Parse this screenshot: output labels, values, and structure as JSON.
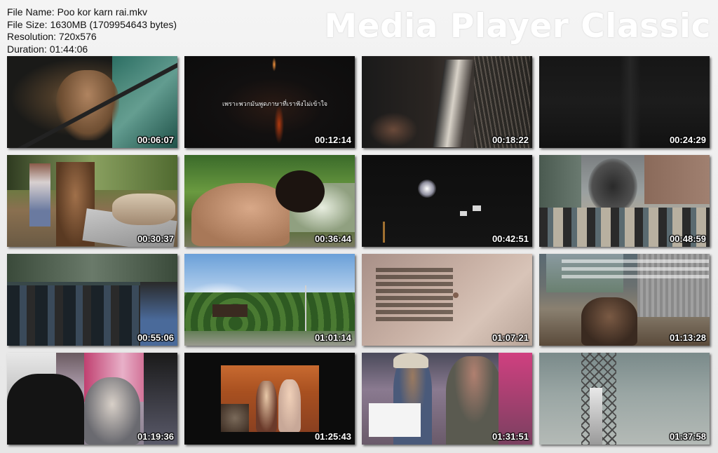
{
  "info": {
    "file_name": "File Name: Poo kor karn rai.mkv",
    "file_size": "File Size: 1630MB (1709954643 bytes)",
    "resolution": "Resolution: 720x576",
    "duration": "Duration: 01:44:06"
  },
  "brand": "Media Player Classic",
  "thumbnails": [
    {
      "time": "00:06:07"
    },
    {
      "time": "00:12:14",
      "caption": "เพราะพวกมันพูดภาษาที่เราฟังไม่เข้าใจ"
    },
    {
      "time": "00:18:22"
    },
    {
      "time": "00:24:29"
    },
    {
      "time": "00:30:37"
    },
    {
      "time": "00:36:44"
    },
    {
      "time": "00:42:51"
    },
    {
      "time": "00:48:59"
    },
    {
      "time": "00:55:06"
    },
    {
      "time": "01:01:14"
    },
    {
      "time": "01:07:21"
    },
    {
      "time": "01:13:28"
    },
    {
      "time": "01:19:36"
    },
    {
      "time": "01:25:43"
    },
    {
      "time": "01:31:51"
    },
    {
      "time": "01:37:58"
    }
  ]
}
